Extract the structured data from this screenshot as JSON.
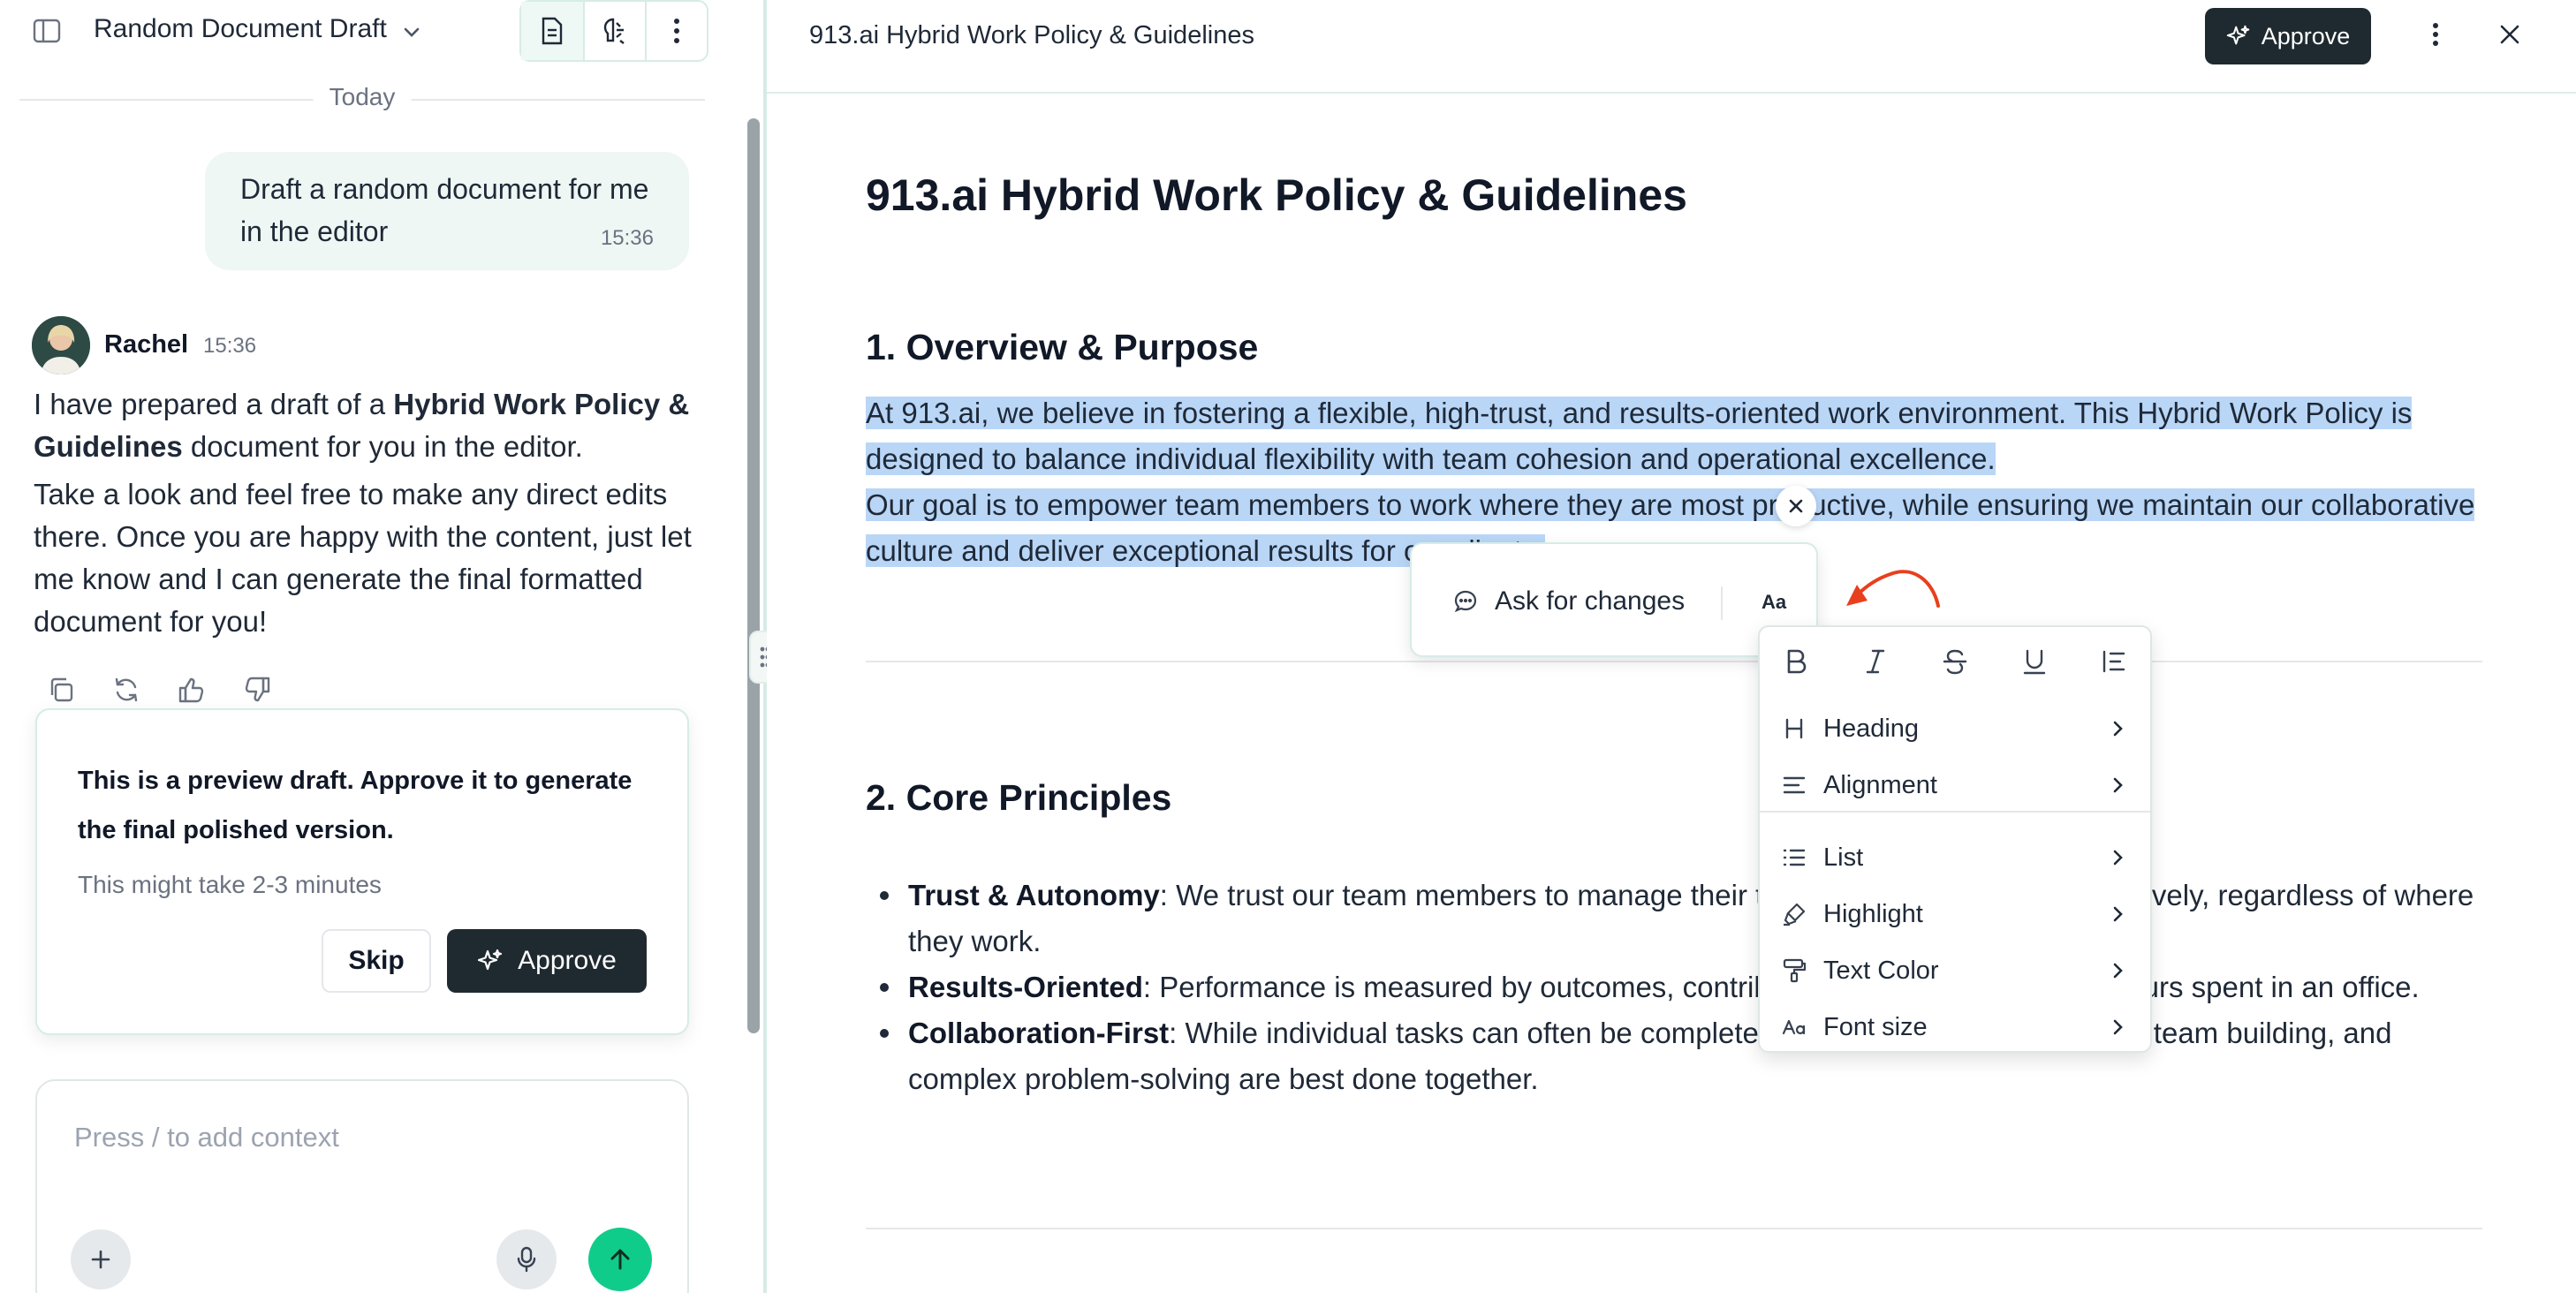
{
  "left_pane": {
    "doc_title": "Random Document Draft",
    "date_separator": "Today",
    "user_message": {
      "text": "Draft a random document for me in the editor",
      "time": "15:36"
    },
    "assistant": {
      "name": "Rachel",
      "time": "15:36",
      "p1_before": "I have prepared a draft of a ",
      "p1_bold": "Hybrid Work Policy & Guidelines",
      "p1_after": " document for you in the editor.",
      "p2": "Take a look and feel free to make any direct edits there. Once you are happy with the content, just let me know and I can generate the final formatted document for you!"
    },
    "preview_card": {
      "title": "This is a preview draft. Approve it to generate the final polished version.",
      "subtitle": "This might take 2-3 minutes",
      "skip_label": "Skip",
      "approve_label": "Approve"
    },
    "composer": {
      "placeholder": "Press / to add context"
    }
  },
  "right_pane": {
    "title": "913.ai Hybrid Work Policy & Guidelines",
    "approve_label": "Approve",
    "doc": {
      "h1": "913.ai Hybrid Work Policy & Guidelines",
      "section1_heading": "1. Overview & Purpose",
      "section1_line1": "At 913.ai, we believe in fostering a flexible, high-trust, and results-oriented work environment. This Hybrid Work Policy is designed to balance individual flexibility with team cohesion and operational excellence.",
      "section1_line2": "Our goal is to empower team members to work where they are most productive, while ensuring we maintain our collaborative culture and deliver exceptional results for our clients.",
      "section2_heading": "2. Core Principles",
      "bullets": [
        {
          "bold": "Trust & Autonomy",
          "text": ": We trust our team members to manage their time and responsibilities effectively, regardless of where they work."
        },
        {
          "bold": "Results-Oriented",
          "text": ": Performance is measured by outcomes, contributions, and impact, not by hours spent in an office."
        },
        {
          "bold": "Collaboration-First",
          "text": ": While individual tasks can often be completed remotely, strategic planning, team building, and complex problem-solving are best done together."
        }
      ]
    },
    "selection_toolbar": {
      "ask_label": "Ask for changes",
      "aa_label": "Aa"
    },
    "format_menu": {
      "items": [
        "Heading",
        "Alignment",
        "List",
        "Highlight",
        "Text Color",
        "Font size"
      ]
    }
  },
  "colors": {
    "accent_green": "#10cc8a",
    "dark_button": "#1f2a30",
    "selection": "#b9d6f7",
    "annotation_arrow": "#e8401c"
  }
}
